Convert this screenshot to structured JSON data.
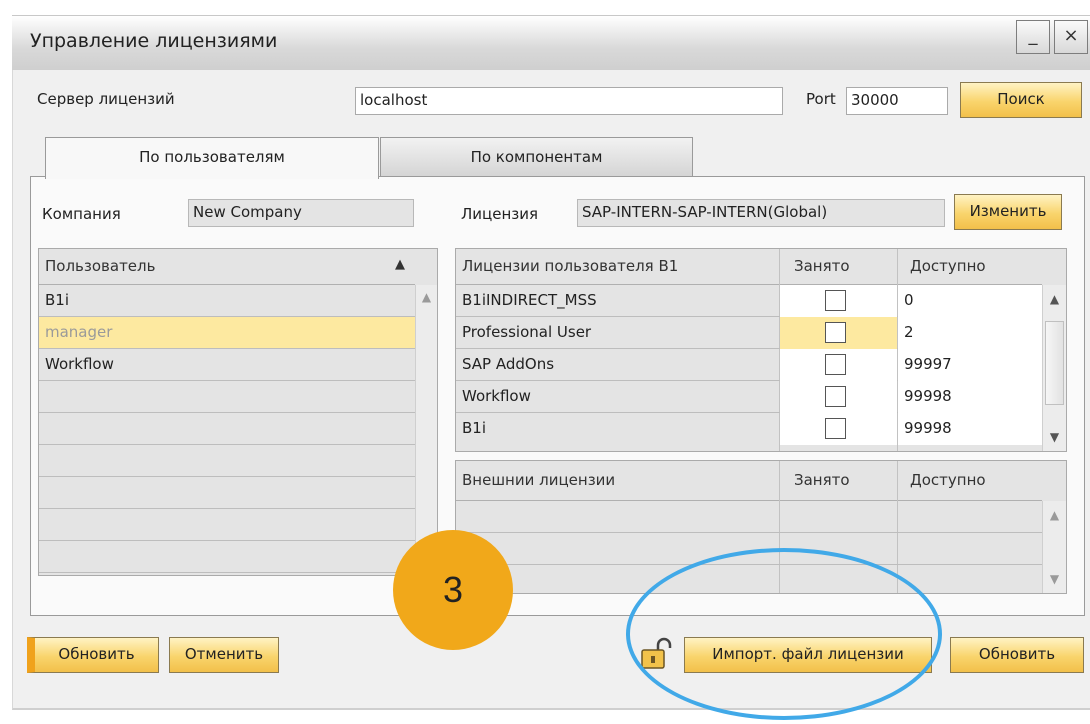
{
  "window": {
    "title": "Управление лицензиями",
    "minimize_glyph": "_",
    "close_glyph": "×"
  },
  "server": {
    "label": "Сервер лицензий",
    "value": "localhost",
    "port_label": "Port",
    "port_value": "30000",
    "search_button": "Поиск"
  },
  "tabs": [
    {
      "label": "По пользователям"
    },
    {
      "label": "По компонентам"
    }
  ],
  "company": {
    "label": "Компания",
    "value": "New Company"
  },
  "license": {
    "label": "Лицензия",
    "value": "SAP-INTERN-SAP-INTERN(Global)",
    "change_button": "Изменить"
  },
  "users": {
    "header": "Пользователь",
    "sort_glyph": "▲",
    "rows": [
      "B1i",
      "manager",
      "Workflow"
    ]
  },
  "user_licenses": {
    "headers": [
      "Лицензии пользователя B1",
      "Занято",
      "Доступно"
    ],
    "rows": [
      {
        "name": "B1iINDIRECT_MSS",
        "available": "0"
      },
      {
        "name": "Professional User",
        "available": "2"
      },
      {
        "name": "SAP AddOns",
        "available": "99997"
      },
      {
        "name": "Workflow",
        "available": "99998"
      },
      {
        "name": "B1i",
        "available": "99998"
      }
    ]
  },
  "external_licenses": {
    "headers": [
      "Внешнии лицензии",
      "Занято",
      "Доступно"
    ]
  },
  "buttons": {
    "update_left": "Обновить",
    "cancel": "Отменить",
    "import": "Импорт. файл лицензии",
    "update_right": "Обновить"
  },
  "annotation": {
    "step_number": "3"
  },
  "colors": {
    "accent": "#f1a81a",
    "selection": "#fde9a0",
    "highlight_circle": "#41a9e8"
  }
}
